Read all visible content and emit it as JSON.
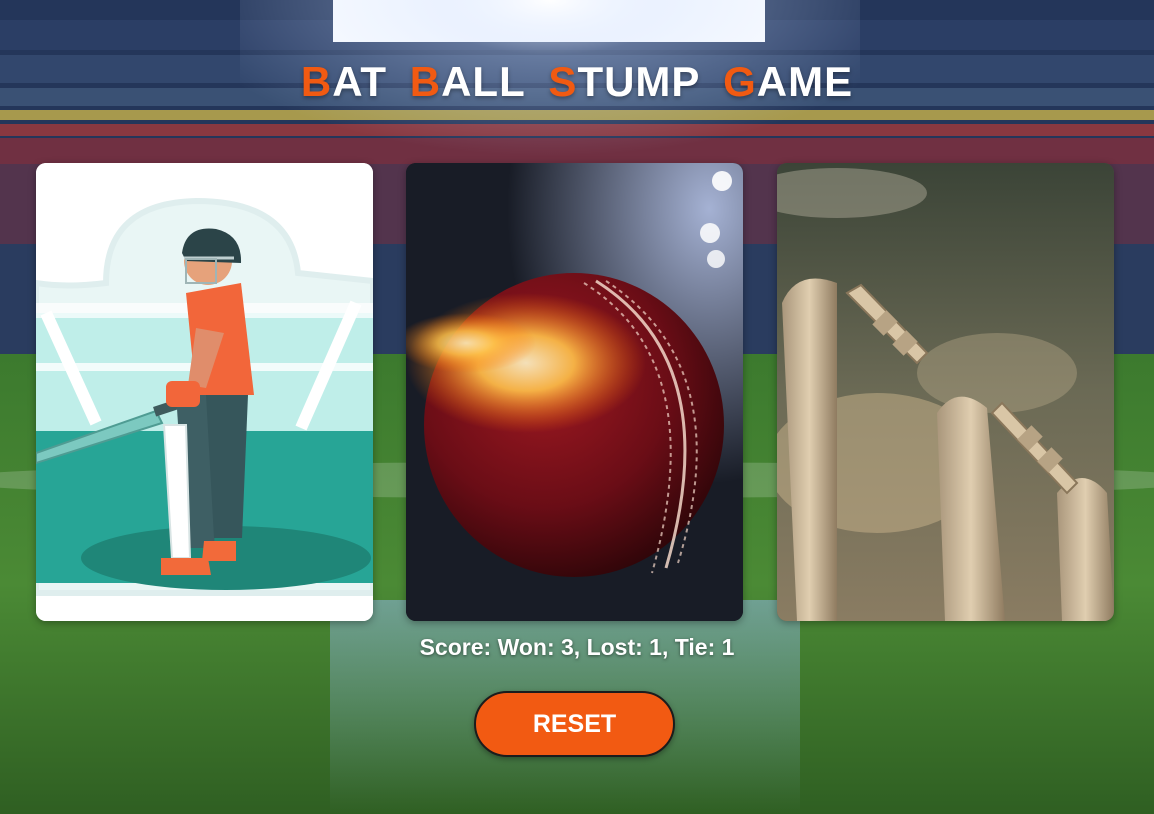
{
  "title": {
    "words": [
      {
        "first": "B",
        "rest": "AT"
      },
      {
        "first": "B",
        "rest": "ALL"
      },
      {
        "first": "S",
        "rest": "TUMP"
      },
      {
        "first": "G",
        "rest": "AME"
      }
    ]
  },
  "cards": {
    "bat": {
      "icon": "batsman-image"
    },
    "ball": {
      "icon": "cricket-ball-image"
    },
    "stump": {
      "icon": "stumps-image"
    }
  },
  "score": {
    "text": "Score: Won: 3, Lost: 1, Tie: 1"
  },
  "reset": {
    "label": "RESET"
  },
  "colors": {
    "accent": "#f15a12",
    "button": "#f25a12",
    "text": "#ffffff"
  }
}
